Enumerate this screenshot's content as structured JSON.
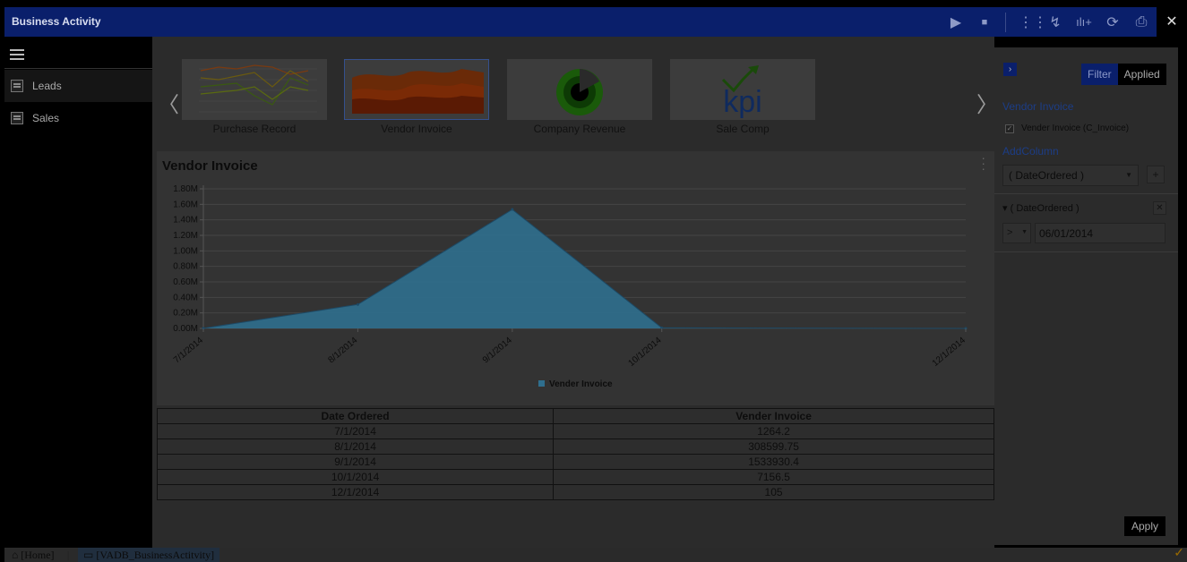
{
  "app": {
    "title": "Business Activity",
    "close_icon": "close-icon",
    "toolbar_icons": [
      "play-icon",
      "stop-icon",
      "grid-icon",
      "trend-add-icon",
      "bar-add-icon",
      "refresh-icon",
      "print-icon"
    ]
  },
  "sidebar": {
    "items": [
      {
        "label": "Leads",
        "active": true
      },
      {
        "label": "Sales",
        "active": false
      }
    ]
  },
  "thumbnails": [
    {
      "label": "Purchase Record",
      "selected": false
    },
    {
      "label": "Vendor Invoice",
      "selected": true
    },
    {
      "label": "Company Revenue",
      "selected": false
    },
    {
      "label": "Sale Comp",
      "selected": false,
      "logo_text": "kpi"
    }
  ],
  "chart_data": {
    "type": "area",
    "title": "Vendor Invoice",
    "x": [
      "7/1/2014",
      "8/1/2014",
      "9/1/2014",
      "10/1/2014",
      "12/1/2014"
    ],
    "series": [
      {
        "name": "Vender Invoice",
        "values": [
          1264.2,
          308599.75,
          1533930.4,
          7156.5,
          105
        ]
      }
    ],
    "ytick_labels": [
      "0.00M",
      "0.20M",
      "0.40M",
      "0.60M",
      "0.80M",
      "1.00M",
      "1.20M",
      "1.40M",
      "1.60M",
      "1.80M"
    ],
    "ylim": [
      0,
      1800000
    ],
    "grid": true,
    "legend": "bottom",
    "color": "#2f6f8e"
  },
  "table": {
    "headers": [
      "Date Ordered",
      "Vender Invoice"
    ],
    "rows": [
      [
        "7/1/2014",
        "1264.2"
      ],
      [
        "8/1/2014",
        "308599.75"
      ],
      [
        "9/1/2014",
        "1533930.4"
      ],
      [
        "10/1/2014",
        "7156.5"
      ],
      [
        "12/1/2014",
        "105"
      ]
    ]
  },
  "filter_panel": {
    "tab_filter": "Filter",
    "tab_applied": "Applied",
    "section_title": "Vendor Invoice",
    "checkbox_label": "Vender Invoice (C_Invoice)",
    "add_column_label": "AddColumn",
    "add_column_value": "( DateOrdered )",
    "filter_field": "( DateOrdered )",
    "operator": ">",
    "filter_value": "06/01/2014",
    "apply_label": "Apply"
  },
  "statusbar": {
    "home": "[Home]",
    "tab": "[VADB_BusinessActitvity]"
  }
}
